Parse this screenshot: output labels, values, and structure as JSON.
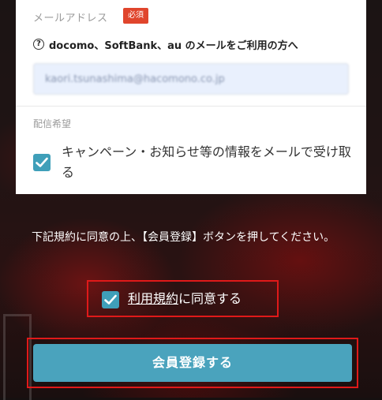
{
  "form": {
    "email_label": "メールアドレス",
    "required_badge": "必須",
    "help_icon": "question-circle-icon",
    "help_text": "docomo、SoftBank、au のメールをご利用の方へ",
    "email_value": "kaori.tsunashima@hacomono.co.jp",
    "delivery_label": "配信希望",
    "newsletter_checked": true,
    "newsletter_text": "キャンペーン・お知らせ等の情報をメールで受け取る"
  },
  "terms": {
    "note": "下記規約に同意の上、【会員登録】ボタンを押してください。",
    "agree_checked": true,
    "agree_link": "利用規約",
    "agree_suffix": "に同意する"
  },
  "submit": {
    "label": "会員登録する"
  },
  "colors": {
    "accent": "#4aa3bd",
    "badge": "#e0452c",
    "highlight_frame": "#e01919",
    "input_bg": "#e9f0fd"
  }
}
